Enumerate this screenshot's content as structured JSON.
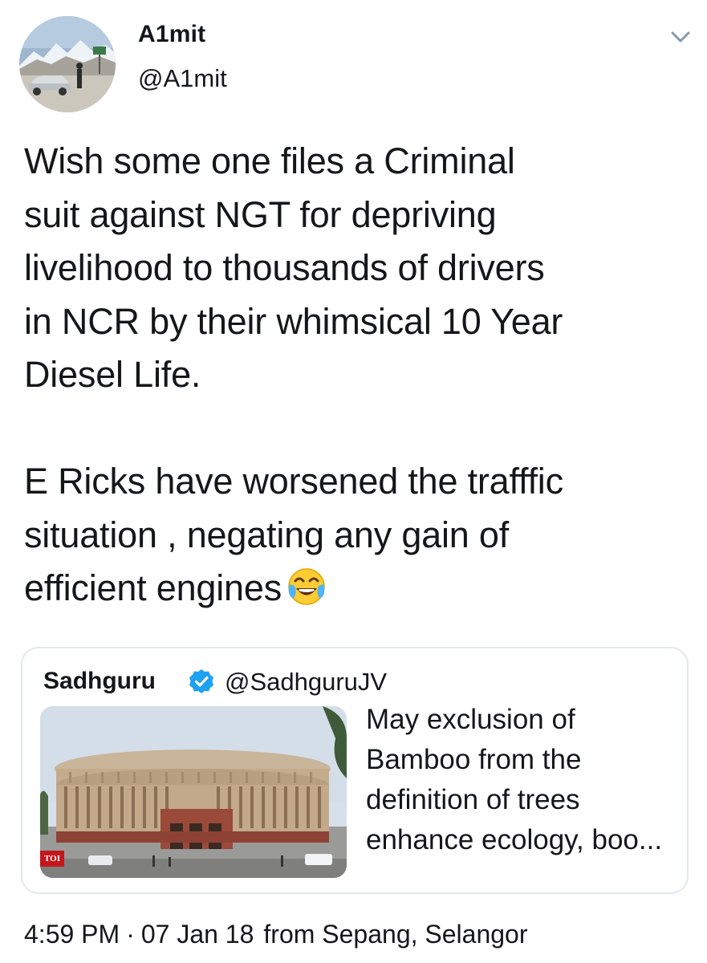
{
  "tweet": {
    "author": {
      "display_name": "A1mit",
      "handle": "@A1mit",
      "avatar_icon": "profile-photo-car-mountains"
    },
    "menu_icon": "chevron-down-icon",
    "text": "Wish some one files a Criminal\nsuit against NGT  for depriving\nlivelihood to thousands of drivers\nin NCR by their whimsical 10 Year\nDiesel Life.\n\nE Ricks have worsened the trafffic\nsituation , negating any gain of\nefficient engines",
    "emoji": "face-with-tears-of-joy",
    "quoted": {
      "display_name": "Sadhguru",
      "verified": true,
      "handle": "@SadhguruJV",
      "text": "May exclusion of\nBamboo from the\ndefinition of trees\nenhance ecology, boo...",
      "image_badge": "TOI",
      "image_icon": "parliament-building-photo"
    },
    "footer": {
      "time": "4:59 PM",
      "separator": "·",
      "date": "07 Jan 18",
      "source": "from Sepang, Selangor"
    },
    "colors": {
      "text": "#14171a",
      "verified_blue": "#1da1f2",
      "card_border": "#e1e8ed",
      "badge_red": "#c4161c"
    }
  }
}
